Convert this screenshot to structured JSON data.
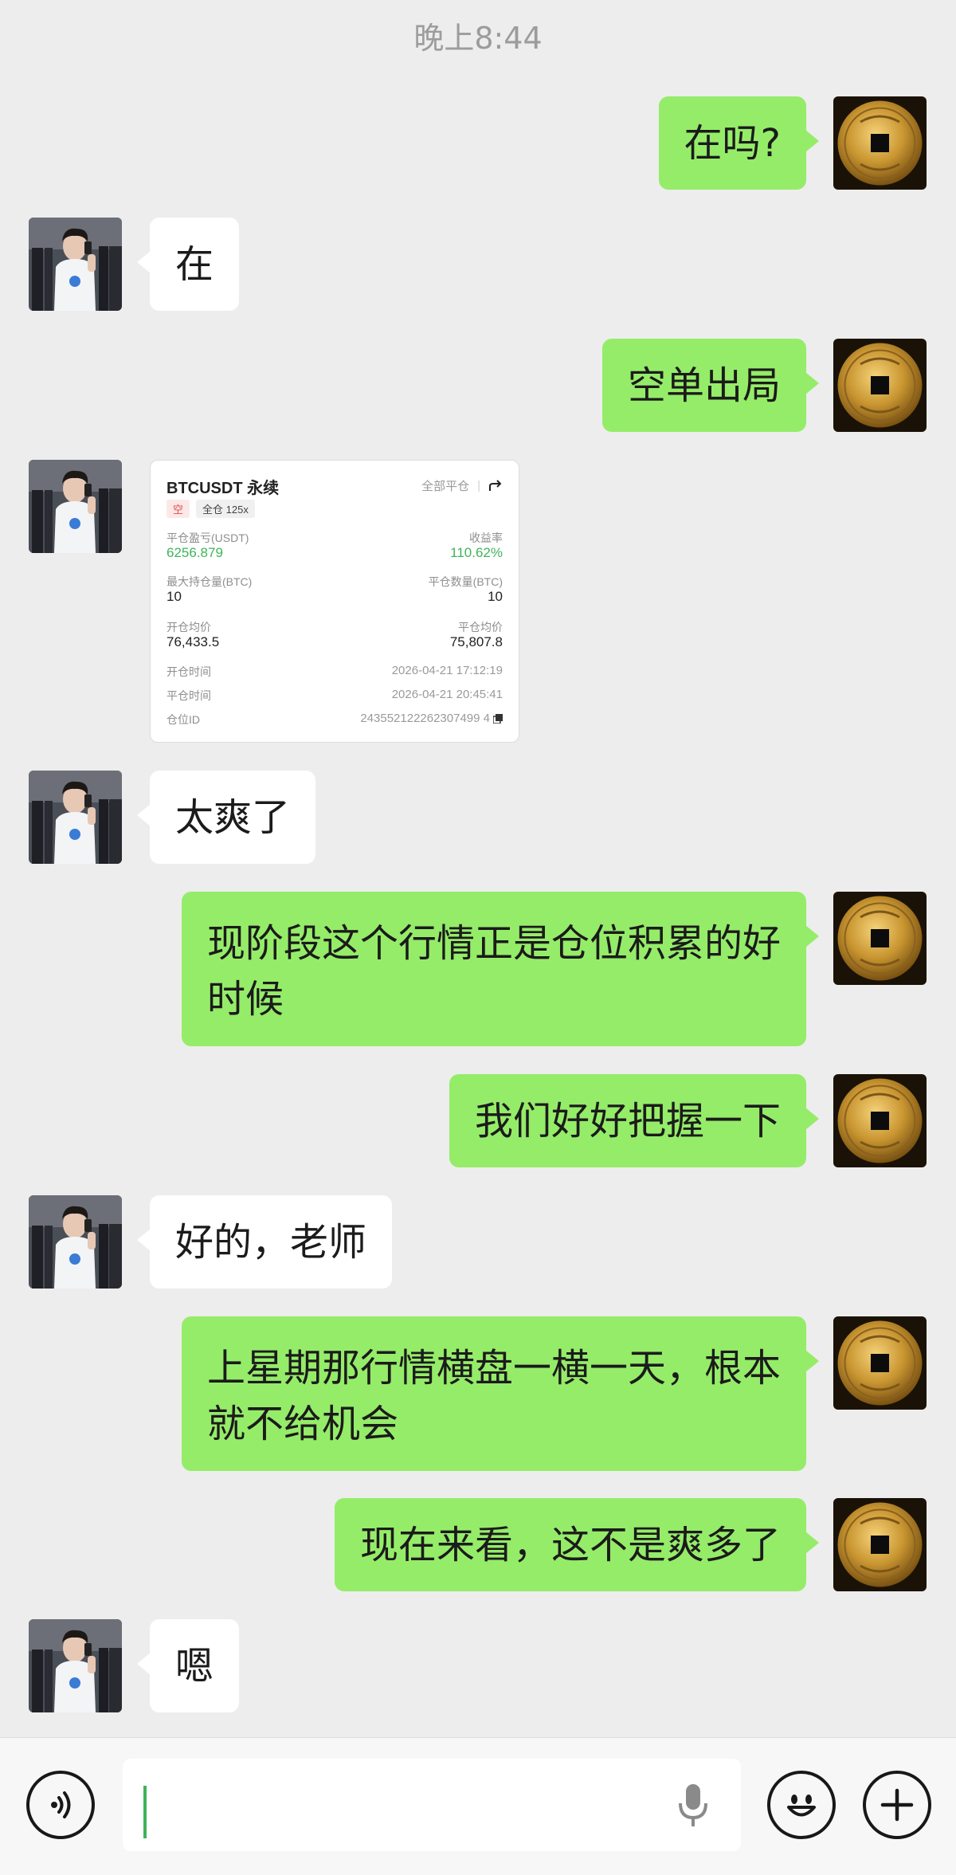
{
  "status": {
    "time": "晚上8:44"
  },
  "messages": [
    {
      "from": "me",
      "text": "在吗?"
    },
    {
      "from": "them",
      "text": "在"
    },
    {
      "from": "me",
      "text": "空单出局"
    },
    {
      "from": "them",
      "type": "trade-card"
    },
    {
      "from": "them",
      "text": "太爽了"
    },
    {
      "from": "me",
      "lines": [
        "现阶段这个行情正是仓位积累的好",
        "时候"
      ]
    },
    {
      "from": "me",
      "text": "我们好好把握一下"
    },
    {
      "from": "them",
      "text": "好的，老师"
    },
    {
      "from": "me",
      "lines": [
        "上星期那行情横盘一横一天，根本",
        "就不给机会"
      ]
    },
    {
      "from": "me",
      "text": "现在来看，这不是爽多了"
    },
    {
      "from": "them",
      "text": "嗯"
    }
  ],
  "trade_card": {
    "symbol": "BTCUSDT 永续",
    "close_all": "全部平仓",
    "direction": "空",
    "margin_mode": "全仓 125x",
    "pnl_label": "平仓盈亏(USDT)",
    "pnl_value": "6256.879",
    "roi_label": "收益率",
    "roi_value": "110.62%",
    "max_pos_label": "最大持仓量(BTC)",
    "max_pos_value": "10",
    "close_qty_label": "平仓数量(BTC)",
    "close_qty_value": "10",
    "open_avg_label": "开仓均价",
    "open_avg_value": "76,433.5",
    "close_avg_label": "平仓均价",
    "close_avg_value": "75,807.8",
    "open_time_label": "开仓时间",
    "open_time_value": "2026-04-21 17:12:19",
    "close_time_label": "平仓时间",
    "close_time_value": "2026-04-21 20:45:41",
    "position_id_label": "仓位ID",
    "position_id_value": "243552122262307499 4"
  },
  "input_bar": {
    "voice_icon": "voice-mode-icon",
    "mic_icon": "microphone-icon",
    "emoji_icon": "emoji-icon",
    "plus_icon": "plus-icon"
  },
  "colors": {
    "background": "#ededed",
    "my_bubble": "#95ec69",
    "their_bubble": "#ffffff",
    "profit_green": "#3fb45a"
  }
}
